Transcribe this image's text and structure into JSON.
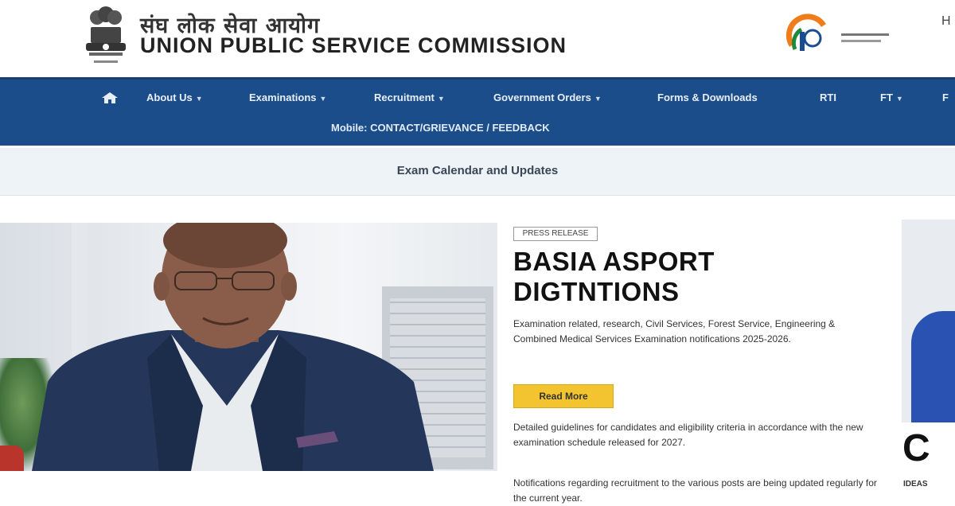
{
  "header": {
    "title_hindi": "संघ लोक सेवा आयोग",
    "title_en": "UNION PUBLIC SERVICE COMMISSION",
    "emblem_icon": "national-emblem-icon",
    "right_logo_icon": "azadi-ka-amrit-mahotsav-logo",
    "edge_glyph": "H",
    "colors": {
      "text": "#222222"
    }
  },
  "nav": {
    "home_icon": "home-icon",
    "items": [
      {
        "label": "About Us",
        "has_dropdown": true
      },
      {
        "label": "Examinations",
        "has_dropdown": true
      },
      {
        "label": "Recruitment",
        "has_dropdown": true
      },
      {
        "label": "Government Orders",
        "has_dropdown": true
      },
      {
        "label": "Forms & Downloads",
        "has_dropdown": false
      },
      {
        "label": "RTI",
        "has_dropdown": false
      },
      {
        "label": "FT",
        "has_dropdown": true
      },
      {
        "label": "F",
        "has_dropdown": false
      }
    ],
    "second_row": "Mobile: CONTACT/GRIEVANCE / FEEDBACK",
    "colors": {
      "background": "#1c4d8b",
      "text": "#e8eef7"
    }
  },
  "strip": {
    "text": "Exam Calendar and Updates"
  },
  "feature": {
    "category_tag": "PRESS RELEASE",
    "headline_line1": "BASIA ASPORT",
    "headline_line2": "DIGTNTIONS",
    "lead_text": "Examination related, research, Civil Services, Forest Service, Engineering & Combined Medical Services Examination notifications 2025-2026.",
    "button_label": "Read More",
    "para1": "Detailed guidelines for candidates and eligibility criteria in accordance with the new examination schedule released for 2027.",
    "para2": "Notifications regarding recruitment to the various posts are being updated regularly for the current year.",
    "colors": {
      "button": "#f3c42f"
    }
  },
  "side": {
    "letter": "C",
    "label": "IDEAS"
  }
}
